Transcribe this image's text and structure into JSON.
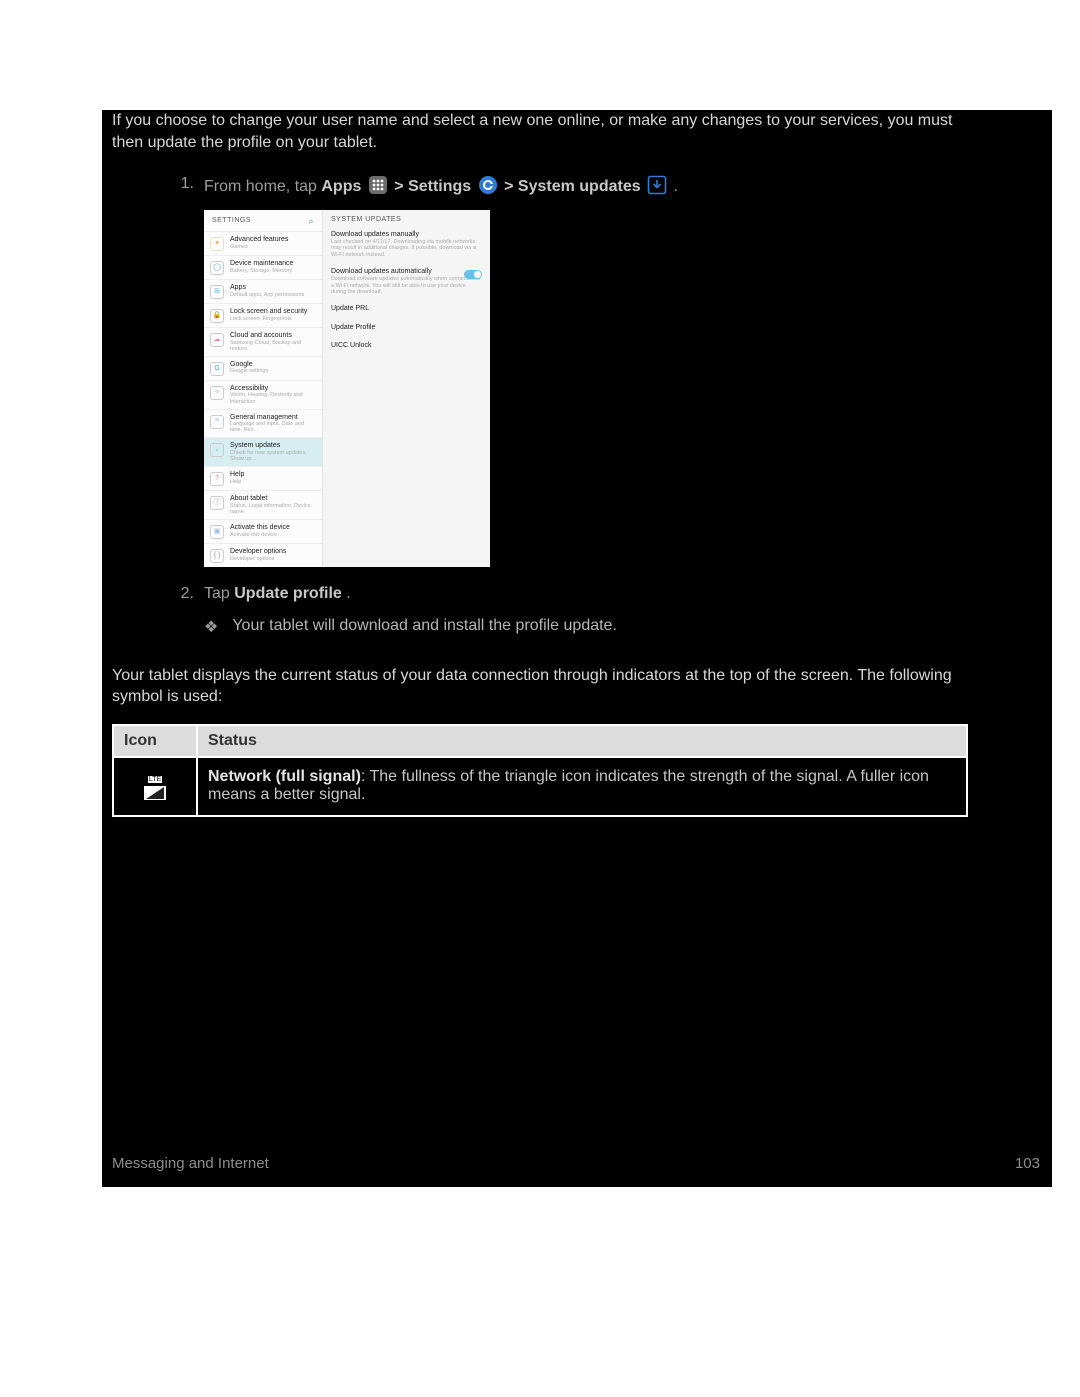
{
  "intro": "If you choose to change your user name and select a new one online, or make any changes to your services, you must then update the profile on your tablet.",
  "step1": {
    "num": "1.",
    "pre": "From home, tap ",
    "apps": "Apps",
    "sep1": "  >  ",
    "settings": "Settings",
    "sep2": "  >  ",
    "sys": "System updates",
    "post": "."
  },
  "step2": {
    "num": "2.",
    "pre": "Tap ",
    "bold": "Update profile",
    "post": "."
  },
  "bullet": {
    "mark": "❖",
    "text": "Your tablet will download and install the profile update."
  },
  "data_desc": "Your tablet displays the current status of your data connection through indicators at the top of the screen. The following symbol is used:",
  "table": {
    "h1": "Icon",
    "h2": "Status",
    "row_bold": "Network (full signal)",
    "row_text": ": The fullness of the triangle icon indicates the strength of the signal. A fuller icon means a better signal.",
    "lte": "LTE"
  },
  "shot": {
    "left_title": "SETTINGS",
    "right_title": "SYSTEM UPDATES",
    "left_items": [
      {
        "t": "Advanced features",
        "s": "Games",
        "ico": "✦",
        "c": "#e6a23c"
      },
      {
        "t": "Device maintenance",
        "s": "Battery, Storage, Memory",
        "ico": "◯",
        "c": "#4aa"
      },
      {
        "t": "Apps",
        "s": "Default apps, App permissions",
        "ico": "⊞",
        "c": "#5bd"
      },
      {
        "t": "Lock screen and security",
        "s": "Lock screen, Fingerprints",
        "ico": "🔒",
        "c": "#999"
      },
      {
        "t": "Cloud and accounts",
        "s": "Samsung Cloud, Backup and restore",
        "ico": "☁",
        "c": "#e8a"
      },
      {
        "t": "Google",
        "s": "Google settings",
        "ico": "G",
        "c": "#4aa"
      },
      {
        "t": "Accessibility",
        "s": "Vision, Hearing, Dexterity and interaction",
        "ico": "✧",
        "c": "#8c6"
      },
      {
        "t": "General management",
        "s": "Language and input, Date and time, Res…",
        "ico": "≡",
        "c": "#9bd"
      },
      {
        "t": "System updates",
        "s": "Check for new system updates, Show up…",
        "ico": "↓",
        "c": "#5bd",
        "sel": true
      },
      {
        "t": "Help",
        "s": "Help",
        "ico": "?",
        "c": "#e8a"
      },
      {
        "t": "About tablet",
        "s": "Status, Legal information, Device name",
        "ico": "ⓘ",
        "c": "#999"
      },
      {
        "t": "Activate this device",
        "s": "Activate this device",
        "ico": "▣",
        "c": "#9bd"
      },
      {
        "t": "Developer options",
        "s": "Developer options",
        "ico": "{ }",
        "c": "#999"
      }
    ],
    "right_items": [
      {
        "t": "Download updates manually",
        "s": "Last checked on 4/11/17. Downloading via mobile networks may result in additional charges. If possible, download via a Wi-Fi network instead."
      },
      {
        "t": "Download updates automatically",
        "s": "Download software updates automatically when connected to a Wi-Fi network. You will still be able to use your device during the download.",
        "toggle": true
      },
      {
        "t": "Update PRL",
        "s": ""
      },
      {
        "t": "Update Profile",
        "s": ""
      },
      {
        "t": "UICC Unlock",
        "s": ""
      }
    ]
  },
  "footer": {
    "section": "Messaging and Internet",
    "page": "103"
  }
}
